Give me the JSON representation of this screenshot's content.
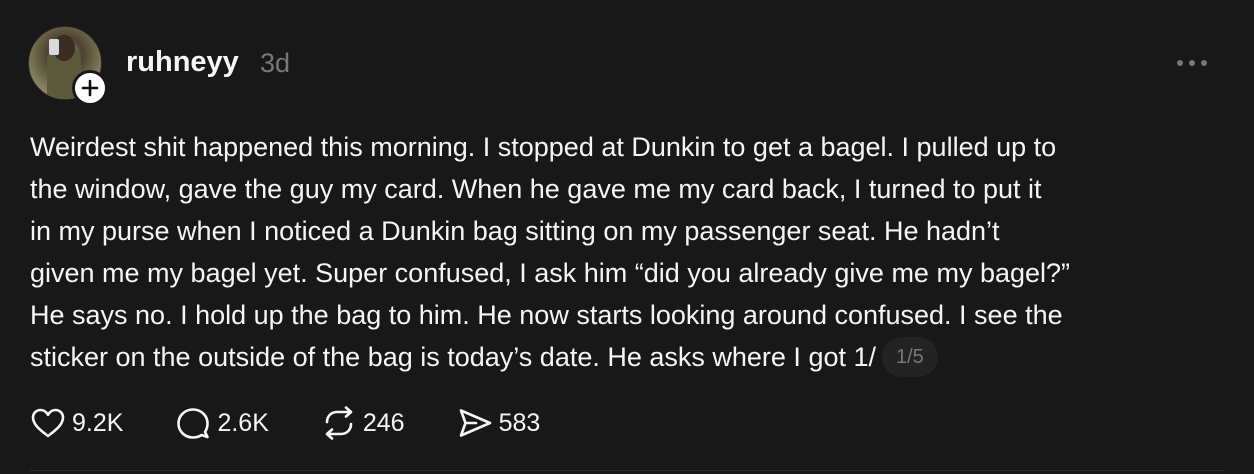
{
  "post": {
    "username": "ruhneyy",
    "timestamp": "3d",
    "body_lines": [
      "Weirdest shit happened this morning. I stopped at Dunkin to get a bagel. I pulled up to",
      "the window, gave the guy my card. When he gave me my card back, I turned to put it",
      "in my purse when I noticed a Dunkin bag sitting on my passenger seat. He hadn’t",
      "given me my bagel yet. Super confused, I ask him “did you already give me my bagel?”",
      "He says no. I hold up the bag to him. He now starts looking around confused. I see the",
      "sticker on the outside of the bag is today’s date. He asks where I got 1/"
    ],
    "page_indicator": "1/5"
  },
  "actions": {
    "likes": "9.2K",
    "comments": "2.6K",
    "reposts": "246",
    "shares": "583"
  },
  "icons": {
    "follow": "plus-icon",
    "more": "more-horizontal-icon",
    "like": "heart-icon",
    "comment": "comment-bubble-icon",
    "repost": "repost-icon",
    "share": "send-icon"
  },
  "colors": {
    "background": "#181818",
    "text": "#f3f5f7",
    "secondary_text": "#777777"
  }
}
